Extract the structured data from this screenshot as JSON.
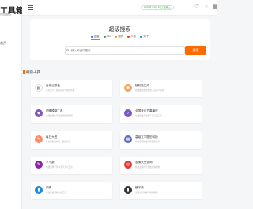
{
  "brand": {
    "title": "工具箱",
    "subtitle": "TOOLBOX"
  },
  "sidebar": {
    "items": [
      {
        "label": "首页"
      }
    ]
  },
  "topbar": {
    "date": "2023年 04月 12日 星期三"
  },
  "search": {
    "title": "超级搜索",
    "engines": [
      {
        "label": "百度",
        "color": "#2979ff"
      },
      {
        "label": "360",
        "color": "#43a047"
      },
      {
        "label": "搜狗",
        "color": "#ff9800"
      },
      {
        "label": "头条",
        "color": "#e53935"
      },
      {
        "label": "知乎",
        "color": "#1e88e5"
      }
    ],
    "placeholder": "输入关键词搜索",
    "button_label": "搜索",
    "accent": "#ff6a00"
  },
  "section": {
    "title": "最新工具"
  },
  "tools": [
    {
      "name": "在线记录板",
      "desc": "记录文字、保存后可以在线查看",
      "icon": "notebook-icon",
      "glyph": "▤",
      "color": "#ffffff",
      "fg": "#333333"
    },
    {
      "name": "随机数生成",
      "desc": "在线随机数生成器，自定义范围",
      "icon": "random-icon",
      "glyph": "◉",
      "color": "#f4a361",
      "fg": "#ffffff"
    },
    {
      "name": "图像模糊工具",
      "desc": "在线给图片添加模糊效果处理",
      "icon": "blur-icon",
      "glyph": "◆",
      "color": "#7e57c2",
      "fg": "#ffffff"
    },
    {
      "name": "全国音乐节奏播放",
      "desc": "在线播放节拍器节奏音频工具",
      "icon": "music-icon",
      "glyph": "♪",
      "color": "#7e57c2",
      "fg": "#ffffff"
    },
    {
      "name": "每日大签",
      "desc": "每日抽取运势签，图文分享",
      "icon": "fortune-icon",
      "glyph": "✎",
      "color": "#ff8a65",
      "fg": "#ffffff"
    },
    {
      "name": "高级文字图形转换",
      "desc": "将文字转换成字符图案显示",
      "icon": "text-art-icon",
      "glyph": "▦",
      "color": "#5c6bc0",
      "fg": "#ffffff"
    },
    {
      "name": "字节数",
      "desc": "在线计算字符串字节大小工具",
      "icon": "bytes-icon",
      "glyph": "✎",
      "color": "#8e24aa",
      "fg": "#ffffff"
    },
    {
      "name": "表情大全查询",
      "desc": "各类表情符号在线查询复制",
      "icon": "emoji-icon",
      "glyph": "◎",
      "color": "#e53935",
      "fg": "#ffffff"
    },
    {
      "name": "词典",
      "desc": "在线汉语词典查询工具",
      "icon": "dictionary-icon",
      "glyph": "▮",
      "color": "#1e88e5",
      "fg": "#ffffff"
    },
    {
      "name": "解字典",
      "desc": "查看汉字拆解与笔顺解析",
      "icon": "character-icon",
      "glyph": "▮",
      "color": "#333333",
      "fg": "#ffffff"
    }
  ]
}
